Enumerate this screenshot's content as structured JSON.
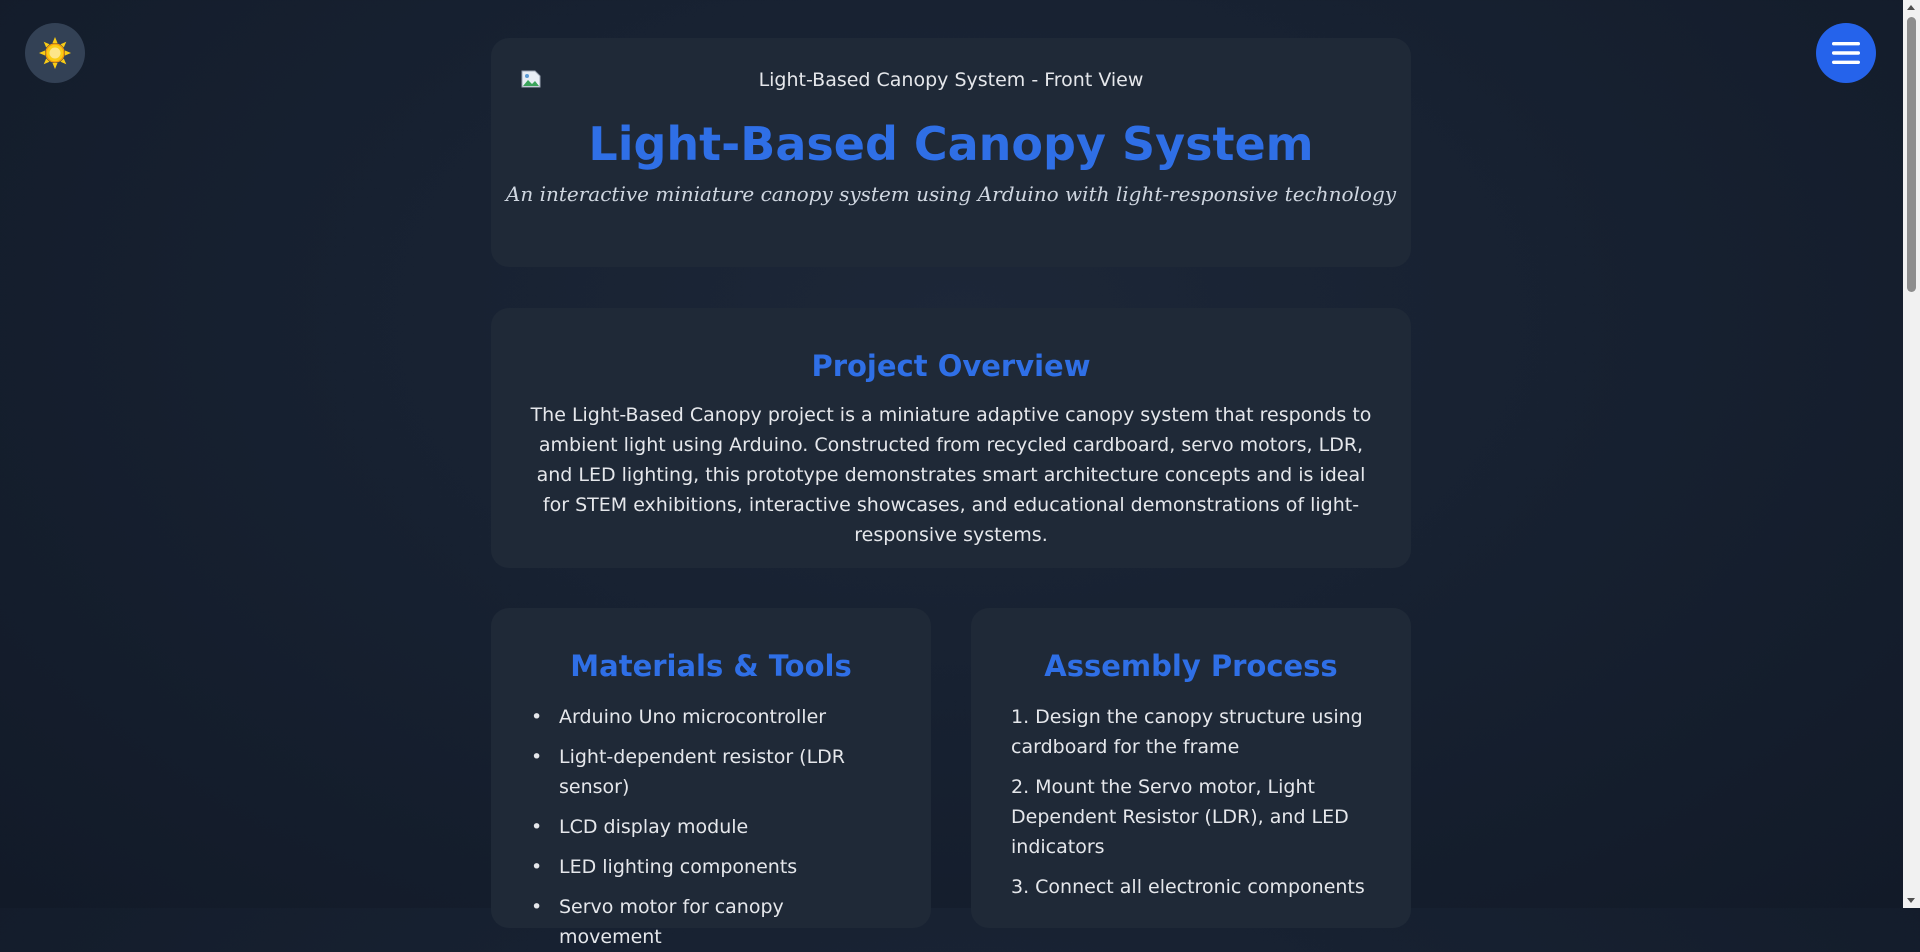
{
  "controls": {
    "theme_icon": "sun-icon",
    "menu_icon": "hamburger-icon"
  },
  "hero": {
    "image_alt": "Light-Based Canopy System - Front View",
    "title": "Light-Based Canopy System",
    "subtitle": "An interactive miniature canopy system using Arduino with light-responsive technology"
  },
  "overview": {
    "heading": "Project Overview",
    "text": "The Light-Based Canopy project is a miniature adaptive canopy system that responds to ambient light using Arduino. Constructed from recycled cardboard, servo motors, LDR, and LED lighting, this prototype demonstrates smart architecture concepts and is ideal for STEM exhibitions, interactive showcases, and educational demonstrations of light-responsive systems."
  },
  "materials": {
    "heading": "Materials & Tools",
    "items": [
      "Arduino Uno microcontroller",
      "Light-dependent resistor (LDR sensor)",
      "LCD display module",
      "LED lighting components",
      "Servo motor for canopy movement"
    ]
  },
  "assembly": {
    "heading": "Assembly Process",
    "steps": [
      "1. Design the canopy structure using cardboard for the frame",
      "2. Mount the Servo motor, Light Dependent Resistor (LDR), and LED indicators",
      "3. Connect all electronic components"
    ]
  },
  "colors": {
    "accent": "#2f6fe6",
    "card": "#1f2937",
    "background": "#172131",
    "menu_button": "#2563eb",
    "sun": "#facc15"
  }
}
